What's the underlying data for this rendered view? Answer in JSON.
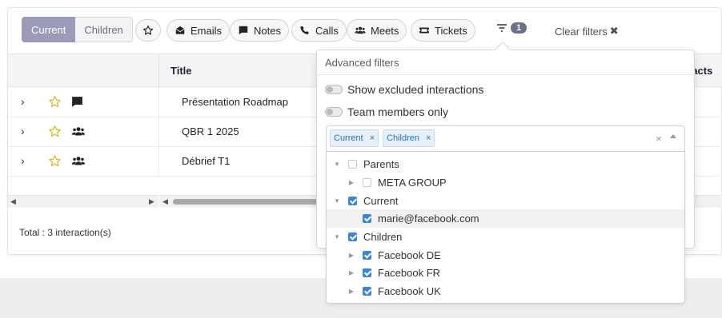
{
  "toolbar": {
    "scope_current": "Current",
    "scope_children": "Children",
    "filters": [
      "Emails",
      "Notes",
      "Calls",
      "Meets",
      "Tickets"
    ],
    "filter_count": "1",
    "clear_filters": "Clear filters"
  },
  "table": {
    "headers": {
      "title": "Title",
      "contacts": "tacts"
    },
    "rows": [
      {
        "icon": "note-icon",
        "title": "Présentation Roadmap"
      },
      {
        "icon": "meeting-icon",
        "title": "QBR 1 2025"
      },
      {
        "icon": "meeting-icon",
        "title": "Débrief T1"
      }
    ],
    "total": "Total : 3 interaction(s)"
  },
  "advanced": {
    "title": "Advanced filters",
    "toggle_excluded": "Show excluded interactions",
    "toggle_team": "Team members only",
    "chips": [
      "Current",
      "Children"
    ],
    "tree": {
      "parents": "Parents",
      "meta_group": "META GROUP",
      "current": "Current",
      "marie": "marie@facebook.com",
      "children": "Children",
      "fb_de": "Facebook DE",
      "fb_fr": "Facebook FR",
      "fb_uk": "Facebook UK"
    }
  },
  "colors": {
    "accent": "#9a9bb8",
    "checkbox": "#3a86d4",
    "star": "#e4b93a"
  }
}
